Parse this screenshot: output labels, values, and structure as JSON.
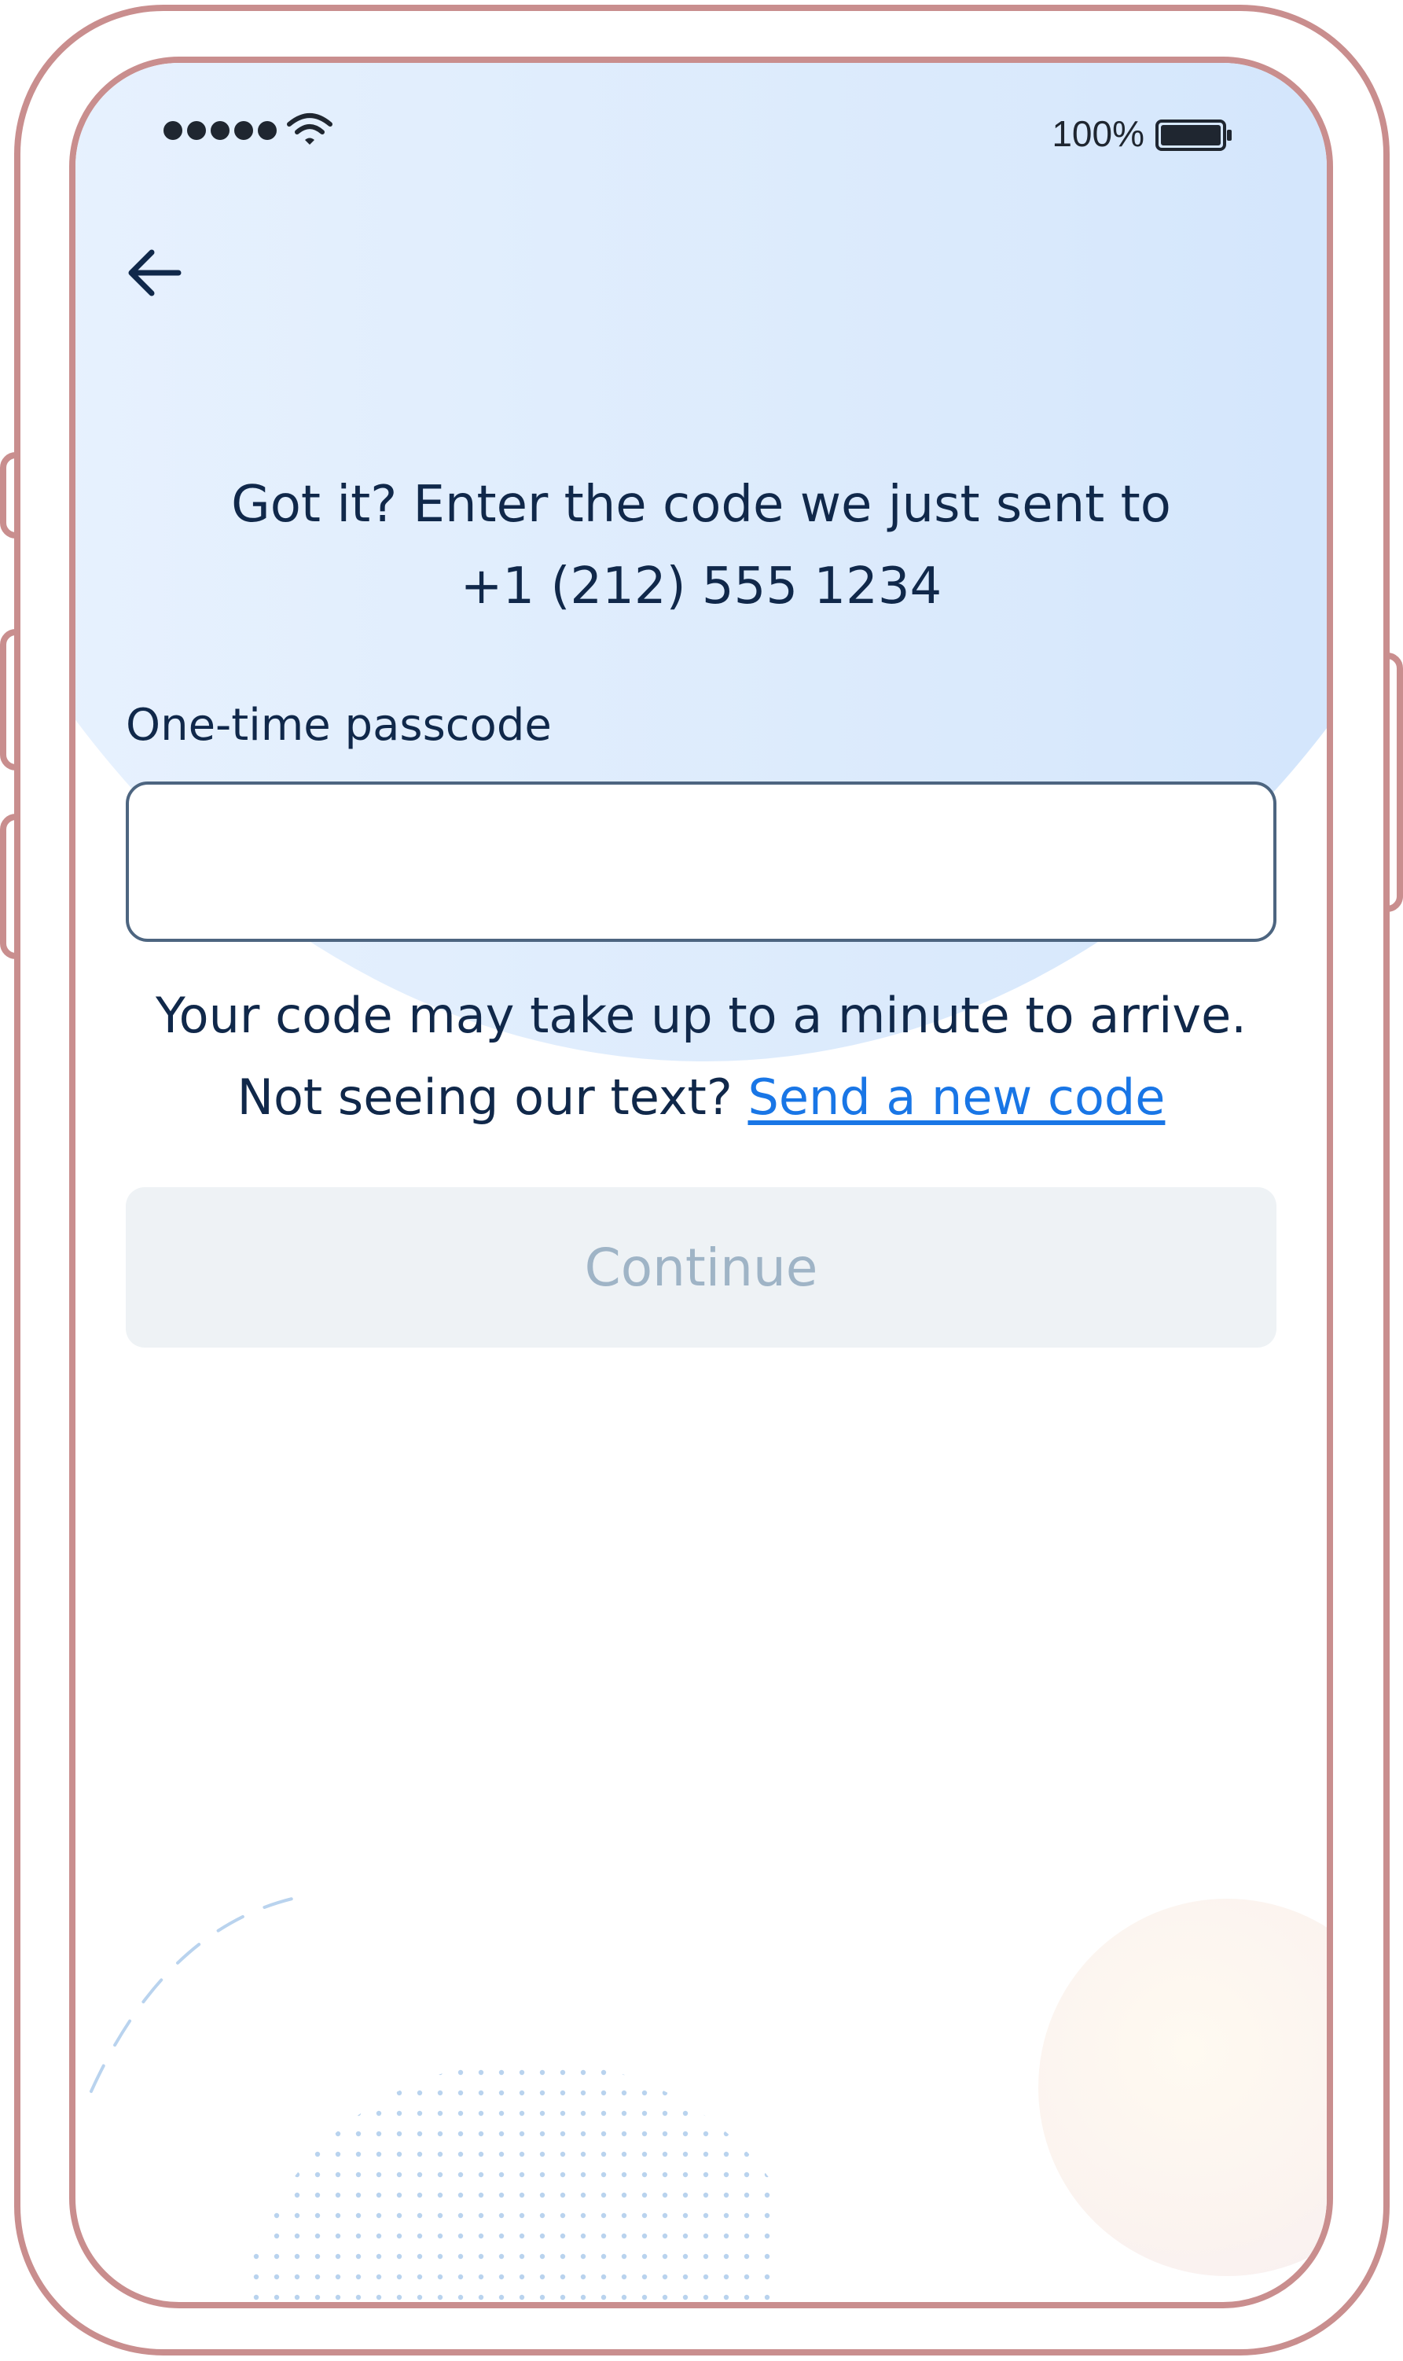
{
  "status_bar": {
    "battery_text": "100%",
    "signal_icon": "signal-dots-icon",
    "wifi_icon": "wifi-icon",
    "battery_icon": "battery-icon"
  },
  "nav": {
    "back_icon": "arrow-left-icon"
  },
  "heading": {
    "line1": "Got it? Enter the code we just sent to",
    "line2": "+1 (212) 555 1234"
  },
  "form": {
    "label": "One-time passcode",
    "value": "",
    "placeholder": ""
  },
  "info": {
    "line1": "Your code may take up to a minute to arrive.",
    "line2_prefix": "Not seeing our text? ",
    "resend_link": "Send a new code"
  },
  "actions": {
    "continue_label": "Continue"
  },
  "colors": {
    "primary_text": "#10284a",
    "link": "#1976e6",
    "disabled_bg": "#eef2f5",
    "disabled_text": "#9fb4c6",
    "frame": "#c98e8e"
  }
}
